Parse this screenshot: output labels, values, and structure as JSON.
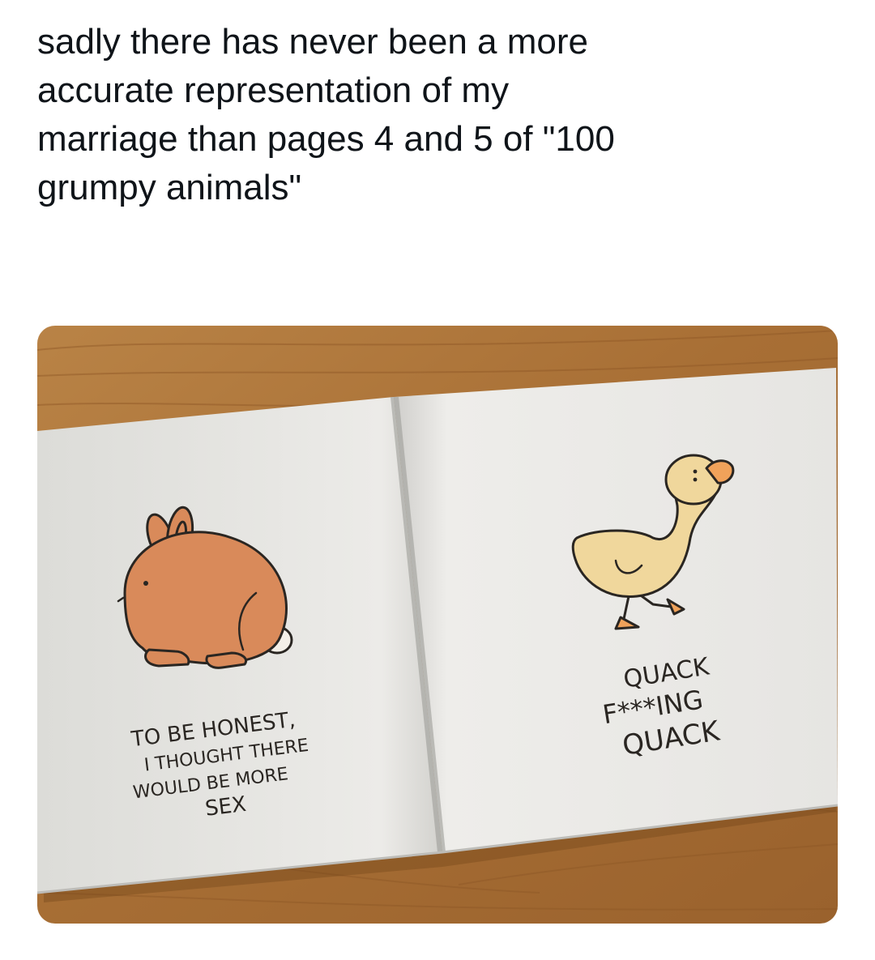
{
  "post": {
    "caption_lines": [
      "sadly there has never been a more",
      "accurate representation of my",
      "marriage than pages 4 and 5 of \"100",
      "grumpy animals\""
    ]
  },
  "photo": {
    "left_page": {
      "animal": "rabbit",
      "text_lines": [
        "TO BE HONEST,",
        "I THOUGHT THERE",
        "WOULD BE MORE",
        "SEX"
      ]
    },
    "right_page": {
      "animal": "duck",
      "text_lines": [
        "QUACK",
        "F***ING",
        "QUACK"
      ]
    },
    "colors": {
      "table": "#b07a3e",
      "page": "#e9e9e6",
      "rabbit": "#d98a5a",
      "duck": "#f0d79c"
    }
  }
}
